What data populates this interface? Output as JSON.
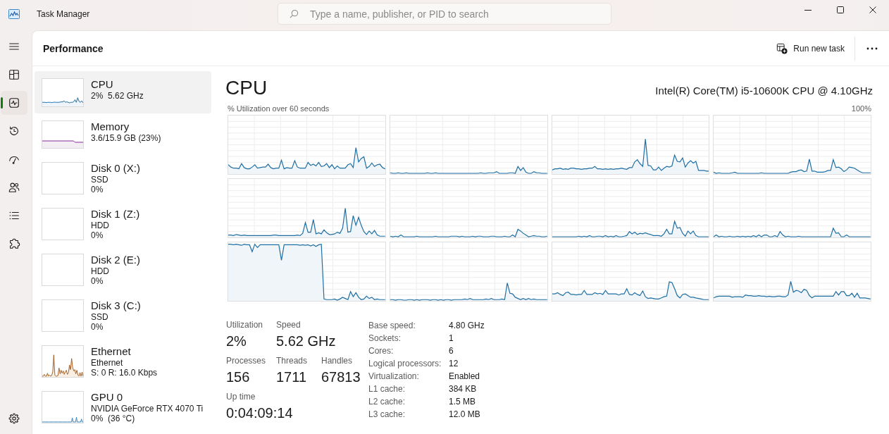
{
  "window": {
    "title": "Task Manager"
  },
  "search": {
    "placeholder": "Type a name, publisher, or PID to search"
  },
  "nav": [
    {
      "kind": "processes",
      "selected": false
    },
    {
      "kind": "performance",
      "selected": true
    },
    {
      "kind": "history",
      "selected": false
    },
    {
      "kind": "startup",
      "selected": false
    },
    {
      "kind": "users",
      "selected": false
    },
    {
      "kind": "details",
      "selected": false
    },
    {
      "kind": "services",
      "selected": false
    }
  ],
  "toolbar": {
    "title": "Performance",
    "buttons": [
      "Run new task"
    ]
  },
  "devices": [
    {
      "kind": "cpu",
      "name": "CPU",
      "details": [
        "2%  5.62 GHz"
      ],
      "selected": true
    },
    {
      "kind": "memory",
      "name": "Memory",
      "details": [
        "3.6/15.9 GB (23%)"
      ],
      "selected": false
    },
    {
      "kind": "disk",
      "name": "Disk 0 (X:)",
      "details": [
        "SSD",
        "0%"
      ],
      "selected": false
    },
    {
      "kind": "disk",
      "name": "Disk 1 (Z:)",
      "details": [
        "HDD",
        "0%"
      ],
      "selected": false
    },
    {
      "kind": "disk",
      "name": "Disk 2 (E:)",
      "details": [
        "HDD",
        "0%"
      ],
      "selected": false
    },
    {
      "kind": "disk",
      "name": "Disk 3 (C:)",
      "details": [
        "SSD",
        "0%"
      ],
      "selected": false
    },
    {
      "kind": "ethernet",
      "name": "Ethernet",
      "details": [
        "Ethernet",
        "S: 0 R: 16.0 Kbps"
      ],
      "selected": false
    },
    {
      "kind": "gpu",
      "name": "GPU 0",
      "details": [
        "NVIDIA GeForce RTX 4070 Ti",
        "0%  (36 °C)"
      ],
      "selected": false
    }
  ],
  "detail": {
    "title": "CPU",
    "model": "Intel(R) Core(TM) i5-10600K CPU @ 4.10GHz",
    "graph_caption": "% Utilization over 60 seconds",
    "graph_max": "100%",
    "stats": [
      [
        {
          "label": "Utilization",
          "value": "2%"
        },
        {
          "label": "Speed",
          "value": "5.62 GHz"
        }
      ],
      [
        {
          "label": "Processes",
          "value": "156"
        },
        {
          "label": "Threads",
          "value": "1711"
        },
        {
          "label": "Handles",
          "value": "67813"
        }
      ],
      [
        {
          "label": "Up time",
          "value": "0:04:09:14"
        }
      ]
    ],
    "specs": [
      {
        "label": "Base speed:",
        "value": "4.80 GHz"
      },
      {
        "label": "Sockets:",
        "value": "1"
      },
      {
        "label": "Cores:",
        "value": "6"
      },
      {
        "label": "Logical processors:",
        "value": "12"
      },
      {
        "label": "Virtualization:",
        "value": "Enabled"
      },
      {
        "label": "L1 cache:",
        "value": "384 KB"
      },
      {
        "label": "L2 cache:",
        "value": "1.5 MB"
      },
      {
        "label": "L3 cache:",
        "value": "12.0 MB"
      }
    ]
  }
}
